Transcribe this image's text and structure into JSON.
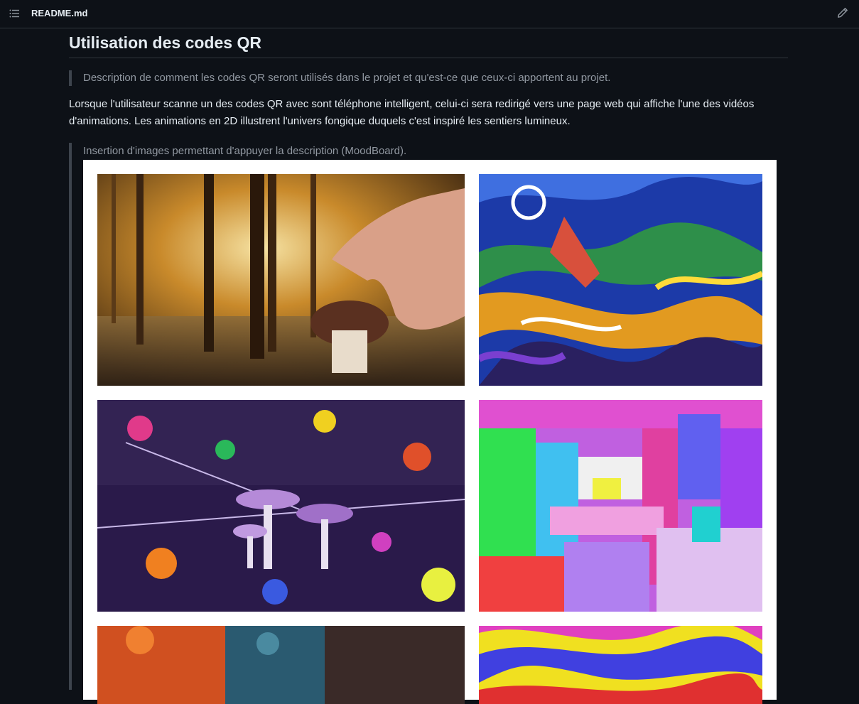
{
  "header": {
    "filename": "README.md",
    "toc_icon": "list-unordered-icon",
    "edit_icon": "pencil-icon"
  },
  "section": {
    "title": "Utilisation des codes QR",
    "quote_intro": "Description de comment les codes QR seront utilisés dans le projet et qu'est-ce que ceux-ci apportent au projet.",
    "paragraph": "Lorsque l'utilisateur scanne un des codes QR avec sont téléphone intelligent, celui-ci sera redirigé vers une page web qui affiche l'une des vidéos d'animations. Les animations en 2D illustrent l'univers fongique duquels c'est inspiré les sentiers lumineux.",
    "quote_images": "Insertion d'images permettant d'appuyer la description (MoodBoard)."
  },
  "moodboard": {
    "images": [
      "autumn-forest-mushroom-photo",
      "psychedelic-landscape-painting",
      "inverted-color-mushrooms-photo",
      "glitch-art-image",
      "fiery-forest-photo-partial",
      "rainbow-swirl-image-partial"
    ]
  },
  "colors": {
    "background": "#0d1117",
    "border": "#30363d",
    "muted_text": "#9198a1",
    "text": "#e6edf3",
    "moodboard_bg": "#ffffff"
  }
}
